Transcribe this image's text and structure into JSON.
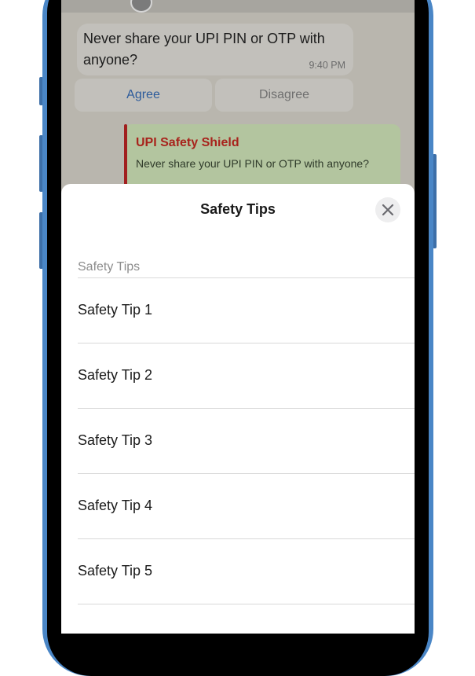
{
  "chat": {
    "message": {
      "text": "Never share your UPI PIN or OTP with anyone?",
      "time": "9:40 PM"
    },
    "quick_replies": {
      "agree": "Agree",
      "disagree": "Disagree"
    },
    "shield_card": {
      "title": "UPI Safety Shield",
      "body": "Never share your UPI PIN or OTP with anyone?"
    }
  },
  "sheet": {
    "title": "Safety Tips",
    "close_icon": "close-icon",
    "section_label": "Safety Tips",
    "tips": [
      {
        "label": "Safety Tip 1"
      },
      {
        "label": "Safety Tip 2"
      },
      {
        "label": "Safety Tip 3"
      },
      {
        "label": "Safety Tip 4"
      },
      {
        "label": "Safety Tip 5"
      }
    ]
  },
  "colors": {
    "accent_blue": "#2c5b9b",
    "alert_red": "#a8231c",
    "shield_bg": "#b3c59f",
    "device_frame": "#4a86c6"
  }
}
